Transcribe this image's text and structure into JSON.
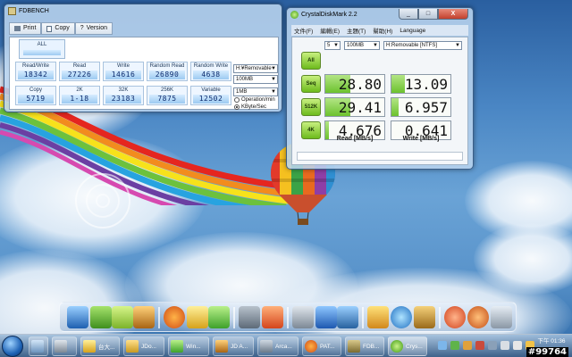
{
  "fdbench": {
    "title": "FDBENCH",
    "toolbar": {
      "print": "Print",
      "copy": "Copy",
      "version": "Version"
    },
    "all_label": "ALL",
    "row1": [
      {
        "label": "Read/Write",
        "value": "18342"
      },
      {
        "label": "Read",
        "value": "27226"
      },
      {
        "label": "Write",
        "value": "14616"
      },
      {
        "label": "Random Read",
        "value": "26890"
      },
      {
        "label": "Random Write",
        "value": "4638"
      }
    ],
    "row2": [
      {
        "label": "Copy",
        "value": "5719"
      },
      {
        "label": "2K",
        "value": "1-18"
      },
      {
        "label": "32K",
        "value": "23183"
      },
      {
        "label": "256K",
        "value": "7875"
      },
      {
        "label": "Variable",
        "value": "12502"
      }
    ],
    "drive_select": "H:¥Removable",
    "size_select": "100MB",
    "block_select": "1MB",
    "radio_operation": "Operation/min",
    "radio_kbyte": "KByte/Sec",
    "radio_selected": "kbyte"
  },
  "cdm": {
    "title": "CrystalDiskMark 2.2",
    "menu": [
      "文件(F)",
      "編輯(E)",
      "主題(T)",
      "幫助(H)",
      "Language"
    ],
    "runs": "5",
    "size": "100MB",
    "drive": "H:Removable [NTFS]",
    "buttons": {
      "all": "All",
      "seq": "Seq",
      "k512": "512K",
      "k4": "4K"
    },
    "read_header": "Read [MB/s]",
    "write_header": "Write [MB/s]",
    "rows": [
      {
        "read": "28.80",
        "write": "13.09",
        "read_fill": 0.42,
        "write_fill": 0.22
      },
      {
        "read": "29.41",
        "write": "6.957",
        "read_fill": 0.43,
        "write_fill": 0.12
      },
      {
        "read": "4.676",
        "write": "0.641",
        "read_fill": 0.06,
        "write_fill": 0.0
      }
    ]
  },
  "window_buttons": {
    "minimize": "_",
    "maximize": "□",
    "close": "X"
  },
  "taskbar": {
    "items": [
      "台大...",
      "JDo...",
      "Win...",
      "JD A...",
      "Arca...",
      "PAT...",
      "FDB...",
      "Crys..."
    ],
    "clock_label": "下午 01:36",
    "clock_date": "",
    "watermark": "#99764"
  }
}
